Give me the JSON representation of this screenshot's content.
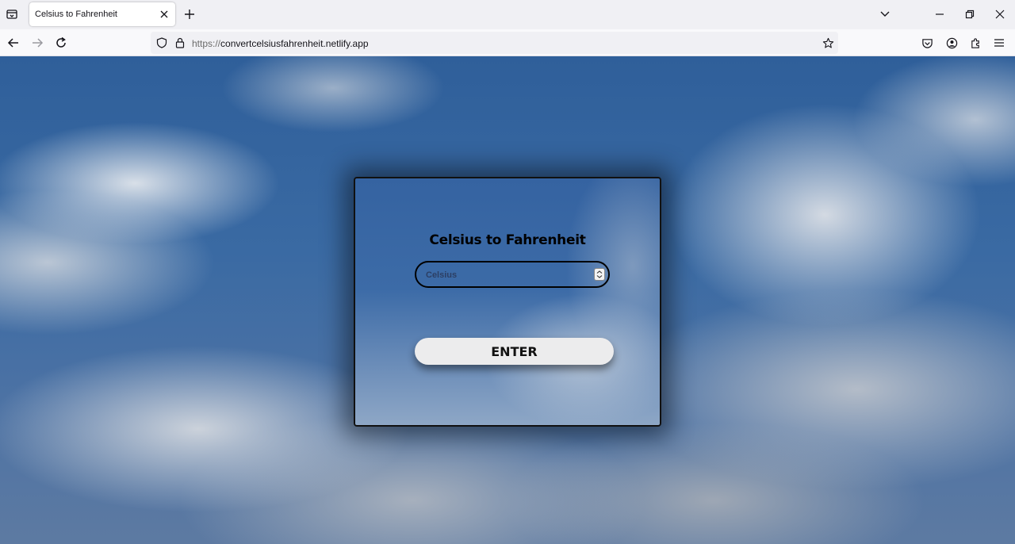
{
  "browser": {
    "tab": {
      "title": "Celsius to Fahrenheit"
    },
    "url": {
      "protocol": "https://",
      "host": "convertcelsiusfahrenheit.netlify.app"
    }
  },
  "app": {
    "title": "Celsius to Fahrenheit",
    "input_placeholder": "Celsius",
    "button_label": "ENTER"
  },
  "icons": [
    "tab-list-icon",
    "close-icon",
    "plus-icon",
    "chevron-down-icon",
    "minimize-icon",
    "restore-icon",
    "close-window-icon",
    "back-icon",
    "forward-icon",
    "reload-icon",
    "shield-icon",
    "lock-icon",
    "star-icon",
    "pocket-icon",
    "account-icon",
    "extensions-icon",
    "menu-icon",
    "spinner-icon"
  ]
}
